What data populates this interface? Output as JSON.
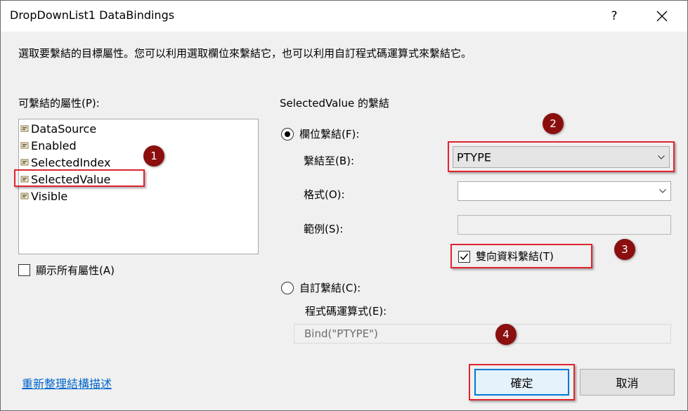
{
  "window": {
    "title": "DropDownList1 DataBindings",
    "help_label": "?",
    "close_icon": "close-icon"
  },
  "instructions": "選取要繫結的目標屬性。您可以利用選取欄位來繫結它，也可以利用自訂程式碼運算式來繫結它。",
  "properties": {
    "label": "可繫結的屬性(P):",
    "items": [
      {
        "label": "DataSource",
        "icon": "property-icon"
      },
      {
        "label": "Enabled",
        "icon": "property-icon"
      },
      {
        "label": "SelectedIndex",
        "icon": "property-icon"
      },
      {
        "label": "SelectedValue",
        "icon": "property-icon"
      },
      {
        "label": "Visible",
        "icon": "property-icon"
      }
    ],
    "show_all_label": "顯示所有屬性(A)",
    "show_all_checked": false
  },
  "binding": {
    "header": "SelectedValue 的繫結",
    "field_binding_label": "欄位繫結(F):",
    "field_binding_selected": true,
    "bind_to_label": "繫結至(B):",
    "bind_to_value": "PTYPE",
    "format_label": "格式(O):",
    "format_value": "",
    "sample_label": "範例(S):",
    "sample_value": "",
    "two_way_label": "雙向資料繫結(T)",
    "two_way_checked": true,
    "custom_binding_label": "自訂繫結(C):",
    "custom_binding_selected": false,
    "expression_label": "程式碼運算式(E):",
    "expression_value": "Bind(\"PTYPE\")"
  },
  "footer": {
    "refresh_link": "重新整理結構描述",
    "ok_label": "確定",
    "cancel_label": "取消"
  },
  "annotations": {
    "badges": [
      "1",
      "2",
      "3",
      "4"
    ],
    "highlight_color": "#e0242f",
    "badge_color": "#8b0f0f"
  }
}
